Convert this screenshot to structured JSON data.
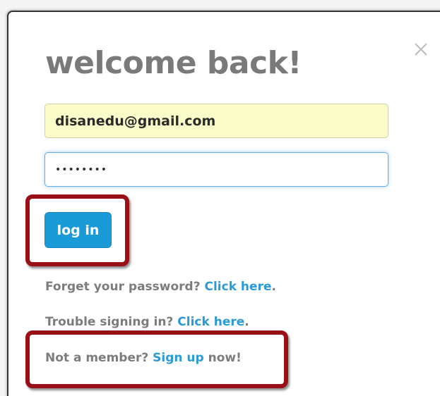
{
  "modal": {
    "title": "welcome back!",
    "close_icon": "close-icon"
  },
  "form": {
    "email_value": "disanedu@gmail.com",
    "password_value": "••••••••",
    "login_label": "log in"
  },
  "help": {
    "forgot_prefix": "Forget your password? ",
    "forgot_link": "Click here",
    "forgot_suffix": ".",
    "trouble_prefix": "Trouble signing in? ",
    "trouble_link": "Click here",
    "trouble_suffix": ".",
    "member_prefix": "Not a member? ",
    "member_link": "Sign up",
    "member_suffix": " now!"
  },
  "colors": {
    "accent": "#1a9ad6",
    "link": "#2a9ad8",
    "highlight": "#9a1018",
    "email_bg": "#fafdc9"
  }
}
